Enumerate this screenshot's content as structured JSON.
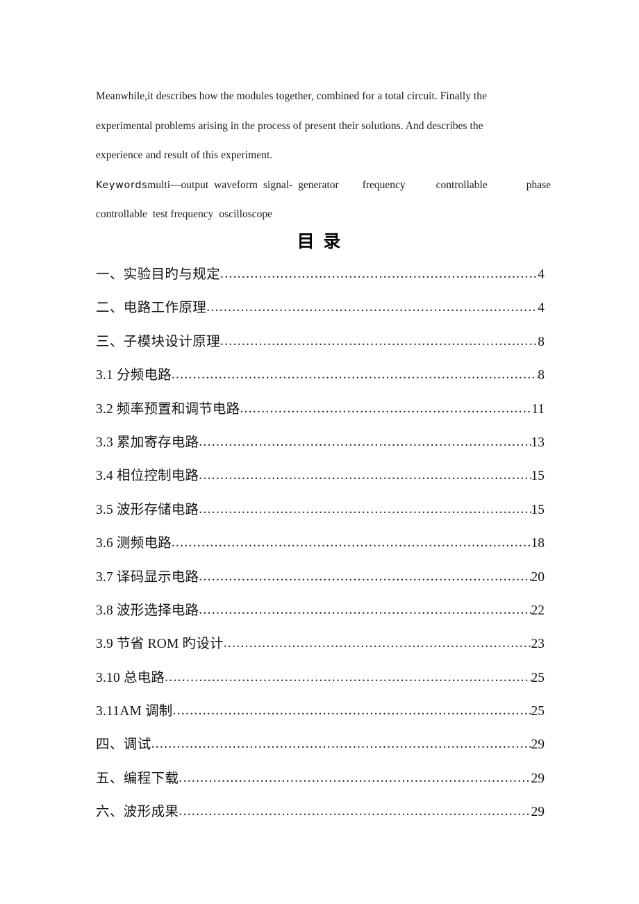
{
  "document": {
    "abstract_tail": {
      "lines": [
        "Meanwhile,it describes how the modules together, combined for a total circuit. Finally the",
        "experimental problems arising in the process of present their solutions. And describes the",
        "experience and result of this experiment."
      ]
    },
    "keywords": {
      "label": "Keywords",
      "line1_terms": [
        "multi—output",
        "waveform",
        "signal-",
        "generator",
        "frequency",
        "controllable",
        "phase"
      ],
      "line2_terms": [
        "controllable",
        "test frequency",
        "oscilloscope"
      ]
    },
    "toc": {
      "title": "目    录",
      "entries": [
        {
          "label": "一、实验目旳与规定",
          "page": "4",
          "level": 1
        },
        {
          "label": "二、电路工作原理",
          "page": "4",
          "level": 1
        },
        {
          "label": "三、子模块设计原理",
          "page": "8",
          "level": 1
        },
        {
          "label": "3.1  分频电路",
          "page": "8",
          "level": 2
        },
        {
          "label": "3.2 频率预置和调节电路",
          "page": "11",
          "level": 2
        },
        {
          "label": "3.3 累加寄存电路",
          "page": "13",
          "level": 2
        },
        {
          "label": "3.4 相位控制电路",
          "page": "15",
          "level": 2
        },
        {
          "label": "3.5 波形存储电路",
          "page": "15",
          "level": 2
        },
        {
          "label": "3.6 测频电路",
          "page": "18",
          "level": 2
        },
        {
          "label": "3.7 译码显示电路",
          "page": "20",
          "level": 2
        },
        {
          "label": "3.8 波形选择电路",
          "page": "22",
          "level": 2
        },
        {
          "label": "3.9  节省 ROM 旳设计",
          "page": "23",
          "level": 2
        },
        {
          "label": "3.10 总电路",
          "page": "25",
          "level": 2
        },
        {
          "label": "3.11AM 调制",
          "page": "25",
          "level": 2
        },
        {
          "label": "四、调试",
          "page": "29",
          "level": 1
        },
        {
          "label": "五、编程下载",
          "page": "29",
          "level": 1
        },
        {
          "label": "六、波形成果",
          "page": "29",
          "level": 1
        }
      ],
      "leader_char": "."
    },
    "colors": {
      "page_background": "#ffffff",
      "text": "#141414"
    }
  }
}
